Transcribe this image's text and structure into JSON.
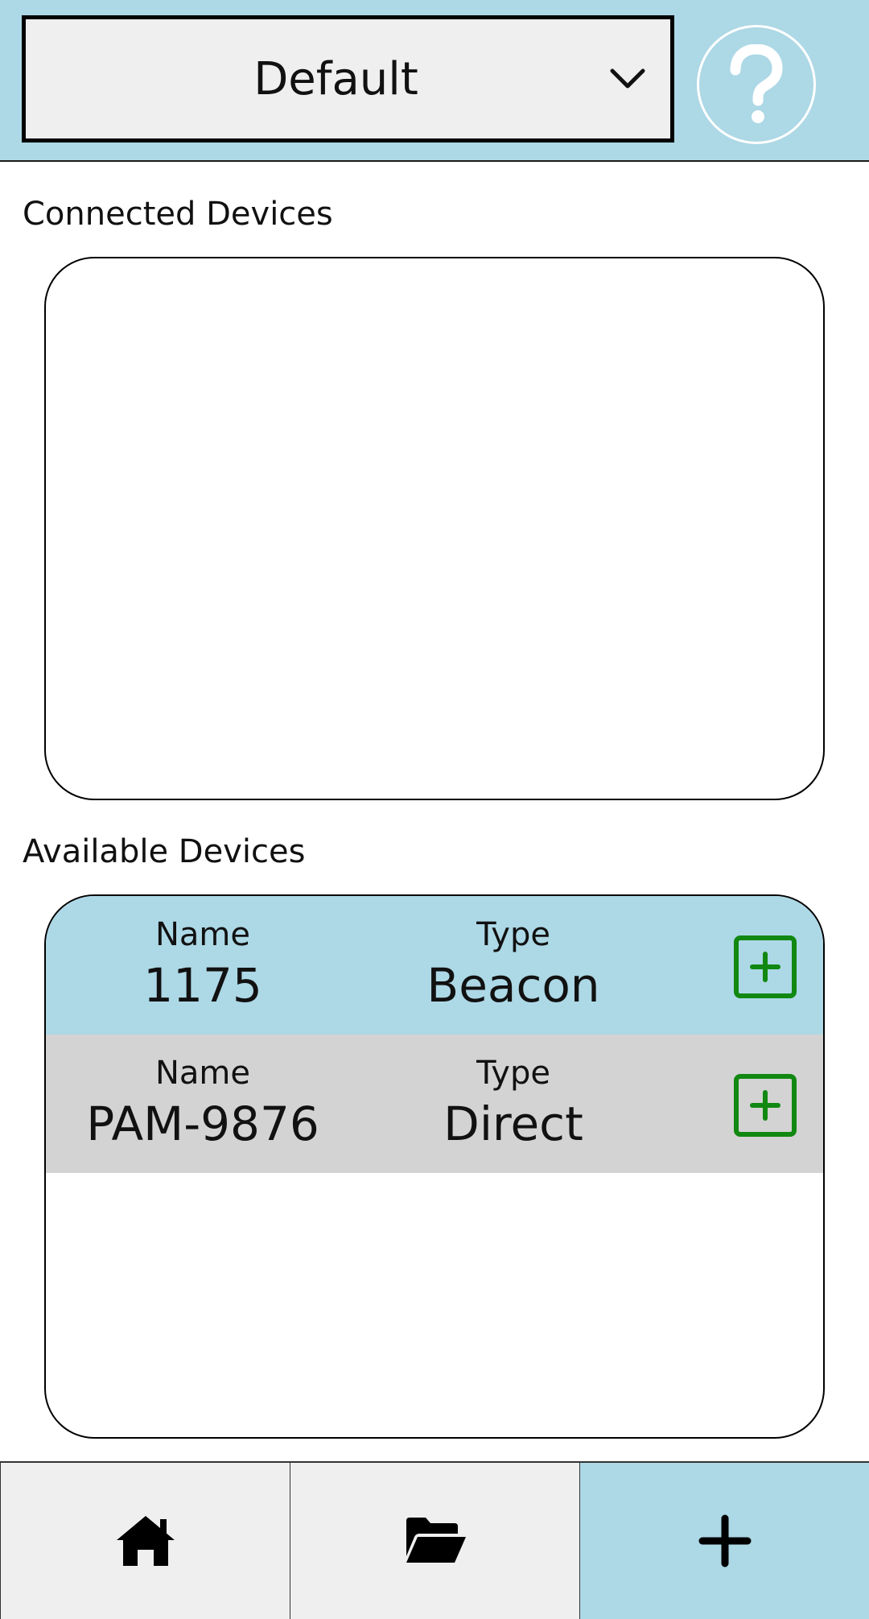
{
  "header": {
    "profile_selected": "Default",
    "help_glyph": "?"
  },
  "sections": {
    "connected_title": "Connected Devices",
    "available_title": "Available Devices"
  },
  "connected_devices": [],
  "available_devices": [
    {
      "name_label": "Name",
      "name": "1175",
      "type_label": "Type",
      "type": "Beacon"
    },
    {
      "name_label": "Name",
      "name": "PAM-9876",
      "type_label": "Type",
      "type": "Direct"
    }
  ],
  "nav": {
    "tabs": [
      {
        "icon": "home-icon",
        "active": false
      },
      {
        "icon": "folder-open-icon",
        "active": false
      },
      {
        "icon": "plus-icon",
        "active": true
      }
    ]
  },
  "colors": {
    "header_bg": "#ADD8E6",
    "row_highlight": "#ADD8E6",
    "row_alt": "#D3D3D3",
    "add_green": "#118811",
    "nav_bg": "#EFEFEF"
  }
}
